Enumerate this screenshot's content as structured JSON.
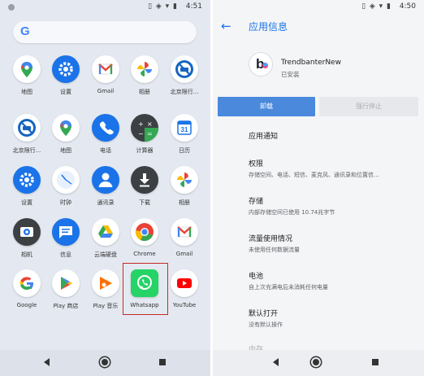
{
  "left": {
    "status_time": "4:51",
    "status_icons": "▯ ◈ ▾ ▮",
    "search_logo": "G",
    "apps": [
      {
        "label": "地图",
        "name": "maps"
      },
      {
        "label": "设置",
        "name": "settings"
      },
      {
        "label": "Gmail",
        "name": "gmail"
      },
      {
        "label": "相册",
        "name": "photos"
      },
      {
        "label": "北京限行...",
        "name": "beijing-traffic"
      },
      {
        "label": "北京限行...",
        "name": "beijing-traffic-2"
      },
      {
        "label": "地图",
        "name": "maps-2"
      },
      {
        "label": "电话",
        "name": "phone"
      },
      {
        "label": "计算器",
        "name": "calculator"
      },
      {
        "label": "日历",
        "name": "calendar"
      },
      {
        "label": "设置",
        "name": "settings-2"
      },
      {
        "label": "时钟",
        "name": "clock"
      },
      {
        "label": "通讯录",
        "name": "contacts"
      },
      {
        "label": "下载",
        "name": "downloads"
      },
      {
        "label": "相册",
        "name": "photos-2"
      },
      {
        "label": "相机",
        "name": "camera"
      },
      {
        "label": "信息",
        "name": "messages"
      },
      {
        "label": "云端硬盘",
        "name": "drive"
      },
      {
        "label": "Chrome",
        "name": "chrome"
      },
      {
        "label": "Gmail",
        "name": "gmail-2"
      },
      {
        "label": "Google",
        "name": "google"
      },
      {
        "label": "Play 商店",
        "name": "play-store"
      },
      {
        "label": "Play 音乐",
        "name": "play-music"
      },
      {
        "label": "Whatsapp",
        "name": "whatsapp"
      },
      {
        "label": "YouTube",
        "name": "youtube"
      }
    ],
    "calendar_day": "31"
  },
  "right": {
    "status_time": "4:50",
    "status_icons": "▯ ◈ ▾ ▮",
    "title": "应用信息",
    "app_name": "TrendbanterNew",
    "app_status": "已安装",
    "uninstall_label": "卸载",
    "force_stop_label": "强行停止",
    "settings": [
      {
        "title": "应用通知",
        "sub": ""
      },
      {
        "title": "权限",
        "sub": "存储空间、电话、短信、麦克风、通讯录和位置信..."
      },
      {
        "title": "存储",
        "sub": "内部存储空间已使用 10.74兆字节"
      },
      {
        "title": "流量使用情况",
        "sub": "未使用任何数据流量"
      },
      {
        "title": "电池",
        "sub": "自上次充满电后未消耗任何电量"
      },
      {
        "title": "默认打开",
        "sub": "没有默认操作"
      },
      {
        "title": "内存",
        "sub": ""
      }
    ]
  },
  "colors": {
    "accent": "#1a73e8",
    "highlight": "#c62828",
    "whatsapp": "#25d366",
    "uninstall": "#4a89dc"
  }
}
